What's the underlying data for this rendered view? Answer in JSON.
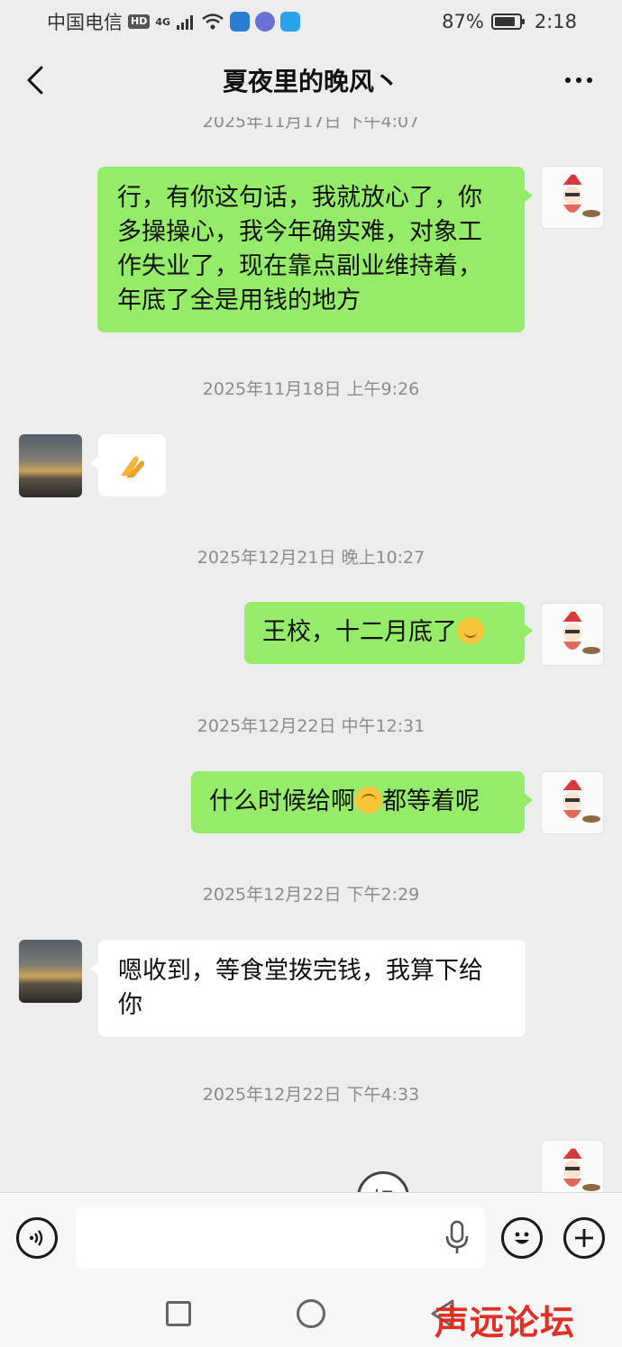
{
  "status_bar": {
    "carrier": "中国电信",
    "hd_badge": "HD",
    "network": "4G",
    "battery_percent": "87%",
    "battery_level": 0.87,
    "time": "2:18"
  },
  "header": {
    "title": "夏夜里的晚风丶",
    "back_icon": "chevron-left-icon",
    "more_icon": "more-dots-icon"
  },
  "messages": [
    {
      "type": "timestamp",
      "text": "2025年11月17日 下午4:07"
    },
    {
      "type": "sent",
      "text": "行，有你这句话，我就放心了，你多操操心，我今年确实难，对象工作失业了，现在靠点副业维持着，年底了全是用钱的地方"
    },
    {
      "type": "timestamp",
      "text": "2025年11月18日 上午9:26"
    },
    {
      "type": "received",
      "emoji": "pray-hands-emoji",
      "text": "🙏"
    },
    {
      "type": "timestamp",
      "text": "2025年12月21日 晚上10:27"
    },
    {
      "type": "sent",
      "text": "王校，十二月底了",
      "emoji": "smile-emoji"
    },
    {
      "type": "timestamp",
      "text": "2025年12月22日 中午12:31"
    },
    {
      "type": "sent",
      "text_before": "什么时候给啊",
      "emoji": "cry-emoji",
      "text_after": "都等着呢"
    },
    {
      "type": "timestamp",
      "text": "2025年12月22日 下午2:29"
    },
    {
      "type": "received",
      "text": "嗯收到，等食堂拨完钱，我算下给你"
    },
    {
      "type": "timestamp",
      "text": "2025年12月22日 下午4:33"
    },
    {
      "type": "sent_sticker_partial",
      "text": "好"
    }
  ],
  "input_bar": {
    "voice_icon": "voice-icon",
    "placeholder": "",
    "mic_icon": "mic-icon",
    "emoji_icon": "emoji-icon",
    "plus_icon": "plus-icon"
  },
  "nav_bar": {
    "recent_icon": "square-icon",
    "home_icon": "circle-icon",
    "back_icon": "triangle-back-icon"
  },
  "watermark": "声远论坛"
}
